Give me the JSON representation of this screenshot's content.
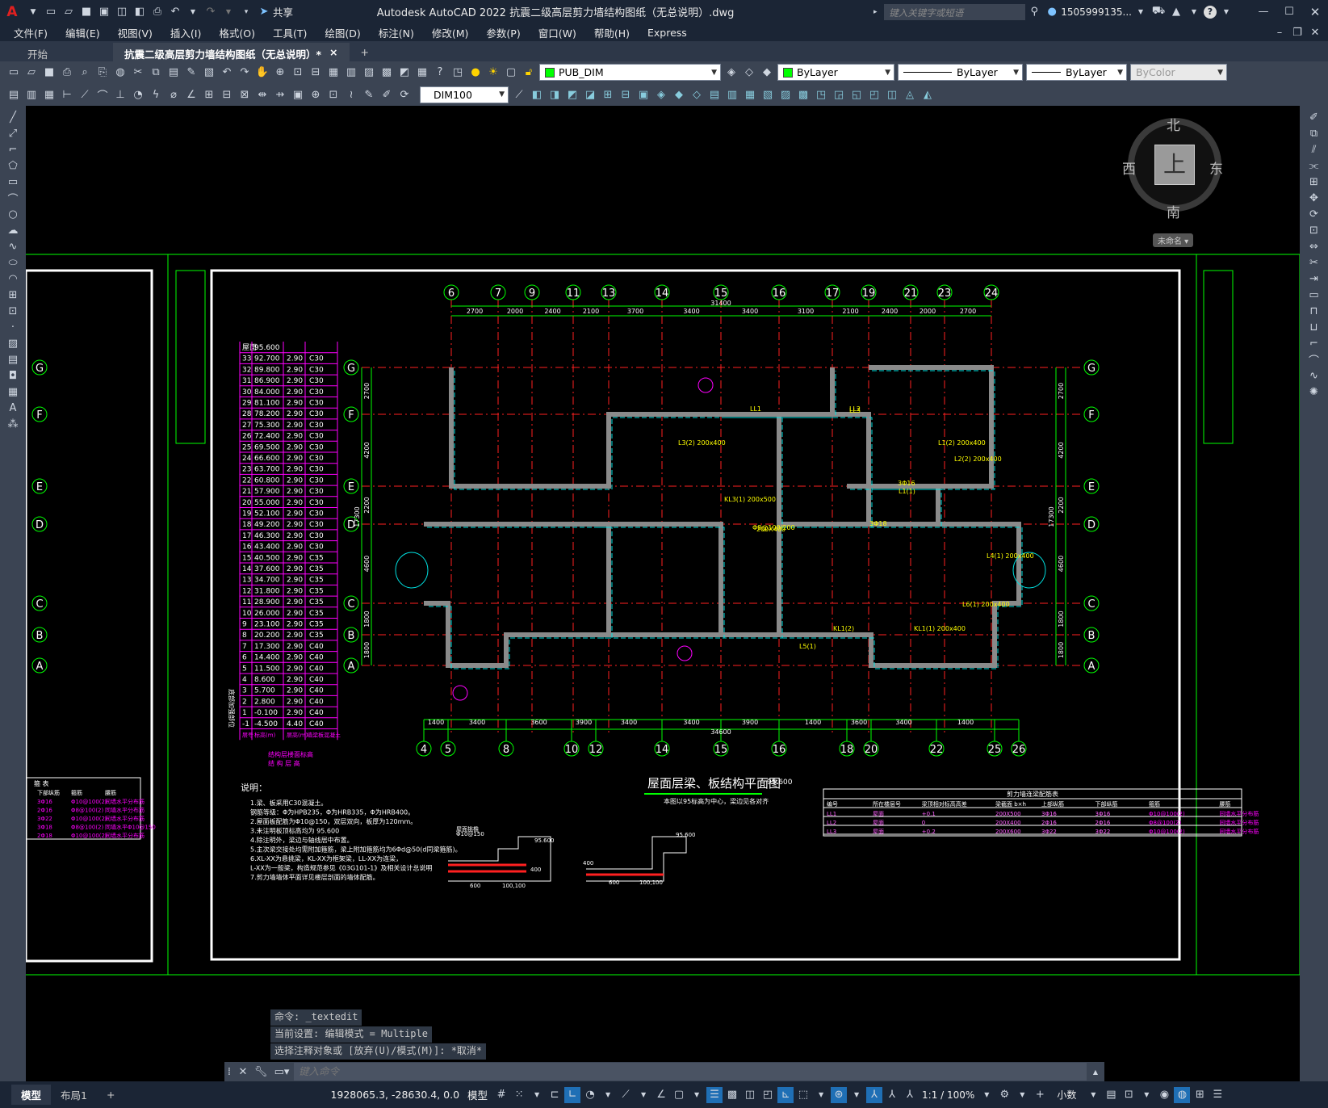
{
  "app": {
    "title": "Autodesk AutoCAD 2022   抗震二级高层剪力墙结构图纸（无总说明）.dwg",
    "share": "共享",
    "search_placeholder": "键入关键字或短语",
    "user": "1505999135...",
    "help": "?"
  },
  "menu": [
    "文件(F)",
    "编辑(E)",
    "视图(V)",
    "插入(I)",
    "格式(O)",
    "工具(T)",
    "绘图(D)",
    "标注(N)",
    "修改(M)",
    "参数(P)",
    "窗口(W)",
    "帮助(H)",
    "Express"
  ],
  "tabs": {
    "start": "开始",
    "doc": "抗震二级高层剪力墙结构图纸（无总说明）*",
    "close": "×",
    "add": "+"
  },
  "props": {
    "layer": "PUB_DIM",
    "color": "ByLayer",
    "linetype": "ByLayer",
    "lineweight": "ByLayer",
    "plotstyle": "ByColor",
    "dimstyle": "DIM100"
  },
  "viewcube": {
    "n": "北",
    "s": "南",
    "e": "东",
    "w": "西",
    "top": "上",
    "ucs": "未命名 ▾"
  },
  "drawing": {
    "title": "屋面层梁、板结构平面图",
    "title_elev": "95.600",
    "subtitle": "本图以95标高为中心，梁边见各对齐",
    "axes_top": [
      "6",
      "7",
      "9",
      "11",
      "13",
      "14",
      "15",
      "16",
      "17",
      "19",
      "21",
      "23",
      "24"
    ],
    "axes_bottom": [
      "4",
      "5",
      "8",
      "10",
      "12",
      "14",
      "15",
      "16",
      "18",
      "20",
      "22",
      "25",
      "26"
    ],
    "axes_side": [
      "G",
      "F",
      "E",
      "D",
      "C",
      "B",
      "A"
    ],
    "dims_top": [
      "2700",
      "2000",
      "2400",
      "2100",
      "3700",
      "3400",
      "3400",
      "3100",
      "2100",
      "2400",
      "2000",
      "2700"
    ],
    "dim_top_total": "31400",
    "dims_bottom": [
      "1400",
      "3400",
      "3600",
      "3900",
      "3400",
      "3400",
      "3900",
      "1400",
      "3600",
      "3400",
      "1400"
    ],
    "dim_bottom_total": "34600",
    "dims_left": [
      "2700",
      "4200",
      "2200",
      "4600",
      "1800",
      "1800"
    ],
    "dim_left_total": "17300",
    "floor_table": [
      [
        "屋面",
        "95.600",
        "",
        ""
      ],
      [
        "33",
        "92.700",
        "2.90",
        "C30"
      ],
      [
        "32",
        "89.800",
        "2.90",
        "C30"
      ],
      [
        "31",
        "86.900",
        "2.90",
        "C30"
      ],
      [
        "30",
        "84.000",
        "2.90",
        "C30"
      ],
      [
        "29",
        "81.100",
        "2.90",
        "C30"
      ],
      [
        "28",
        "78.200",
        "2.90",
        "C30"
      ],
      [
        "27",
        "75.300",
        "2.90",
        "C30"
      ],
      [
        "26",
        "72.400",
        "2.90",
        "C30"
      ],
      [
        "25",
        "69.500",
        "2.90",
        "C30"
      ],
      [
        "24",
        "66.600",
        "2.90",
        "C30"
      ],
      [
        "23",
        "63.700",
        "2.90",
        "C30"
      ],
      [
        "22",
        "60.800",
        "2.90",
        "C30"
      ],
      [
        "21",
        "57.900",
        "2.90",
        "C30"
      ],
      [
        "20",
        "55.000",
        "2.90",
        "C30"
      ],
      [
        "19",
        "52.100",
        "2.90",
        "C30"
      ],
      [
        "18",
        "49.200",
        "2.90",
        "C30"
      ],
      [
        "17",
        "46.300",
        "2.90",
        "C30"
      ],
      [
        "16",
        "43.400",
        "2.90",
        "C30"
      ],
      [
        "15",
        "40.500",
        "2.90",
        "C35"
      ],
      [
        "14",
        "37.600",
        "2.90",
        "C35"
      ],
      [
        "13",
        "34.700",
        "2.90",
        "C35"
      ],
      [
        "12",
        "31.800",
        "2.90",
        "C35"
      ],
      [
        "11",
        "28.900",
        "2.90",
        "C35"
      ],
      [
        "10",
        "26.000",
        "2.90",
        "C35"
      ],
      [
        "9",
        "23.100",
        "2.90",
        "C35"
      ],
      [
        "8",
        "20.200",
        "2.90",
        "C35"
      ],
      [
        "7",
        "17.300",
        "2.90",
        "C40"
      ],
      [
        "6",
        "14.400",
        "2.90",
        "C40"
      ],
      [
        "5",
        "11.500",
        "2.90",
        "C40"
      ],
      [
        "4",
        "8.600",
        "2.90",
        "C40"
      ],
      [
        "3",
        "5.700",
        "2.90",
        "C40"
      ],
      [
        "2",
        "2.800",
        "2.90",
        "C40"
      ],
      [
        "1",
        "-0.100",
        "2.90",
        "C40"
      ],
      [
        "-1",
        "-4.500",
        "4.40",
        "C40"
      ]
    ],
    "floor_table_footer": [
      "层号",
      "标高(m)",
      "层高(m)",
      "墙梁板混凝土"
    ],
    "floor_table_caption": "结构层楼面标高\n结 构 层 高",
    "floor_side_label": "底部加强部位",
    "notes_title": "说明：",
    "notes": [
      "1.梁、板采用C30混凝土。",
      "  钢筋等级：Φ为HPB235，Φ为HRB335，Φ为HRB400。",
      "2.屋面板配筋为Φ10@150，双层双向，板厚为120mm。",
      "3.未注明板顶标高均为  95.600",
      "4.除注明外，梁边与轴线居中布置。",
      "5.主次梁交接处均需附加箍筋，梁上附加箍筋均为6Φd@50(d同梁箍筋)。",
      "6.XL-XX为悬挑梁，KL-XX为框架梁，LL-XX为连梁，",
      "  L-XX为一般梁，构造规范参见《03G101-1》及相关设计总说明",
      "7.剪力墙墙体平面详见楼层剖面的墙体配筋。"
    ],
    "ll_table_title": "剪力墙连梁配筋表",
    "ll_headers": [
      "编号",
      "所在楼层号",
      "梁顶相对标高高差",
      "梁截面 b×h",
      "上部纵筋",
      "下部纵筋",
      "箍筋",
      "腰筋"
    ],
    "ll_rows": [
      [
        "LL1",
        "屋面",
        "+0.1",
        "200X500",
        "3Φ16",
        "3Φ16",
        "Φ10@100(2)",
        "同墙水平分布筋"
      ],
      [
        "LL2",
        "屋面",
        "0",
        "200X400",
        "2Φ16",
        "2Φ16",
        "Φ8@100(2)",
        "同墙水平分布筋"
      ],
      [
        "LL3",
        "屋面",
        "+0.2",
        "200X600",
        "3Φ22",
        "3Φ22",
        "Φ10@100(2)",
        "同墙水平分布筋"
      ]
    ],
    "left_table_title": "箍 表",
    "left_table_headers": [
      "下部纵筋",
      "箍筋",
      "腰筋"
    ],
    "left_table_rows": [
      [
        "3Φ16",
        "Φ10@100(2)",
        "同墙水平分布筋"
      ],
      [
        "2Φ16",
        "Φ8@100(2)",
        "同墙水平分布筋"
      ],
      [
        "3Φ22",
        "Φ10@100(2)",
        "同墙水平分布筋"
      ],
      [
        "3Φ18",
        "Φ8@100(2)",
        "同墙水平Φ10@150"
      ],
      [
        "2Φ18",
        "Φ10@100(2)",
        "同墙水平分布筋"
      ]
    ],
    "beam_labels": [
      "LL1",
      "LL2",
      "L3(2) 200x400",
      "KL1(2)",
      "L5(1)",
      "LL3",
      "L6(1) 200x400",
      "L4(1) 200x400",
      "KL1(1) 200x400",
      "L1(1)",
      "KL3(1) 200x500",
      "3Φ18",
      "3Φ16",
      "Φ8@100/200",
      "200X400",
      "L1(2) 200x400",
      "L2(2) 200x400"
    ],
    "section_labels": [
      "屋面挑檐",
      "95.600",
      "Φ10@150",
      "400",
      "600",
      "100,100"
    ],
    "section2_labels": [
      "95.600",
      "600",
      "100,100",
      "400"
    ]
  },
  "command": {
    "line1": "命令:  _textedit",
    "line2": "当前设置: 编辑模式 = Multiple",
    "line3": "选择注释对象或 [放弃(U)/模式(M)]: *取消*",
    "placeholder": "键入命令"
  },
  "status": {
    "model_tab": "模型",
    "layout_tab": "布局1",
    "add": "+",
    "coords": "1928065.3, -28630.4, 0.0",
    "model": "模型",
    "scale": "1:1 / 100%",
    "units": "小数"
  }
}
